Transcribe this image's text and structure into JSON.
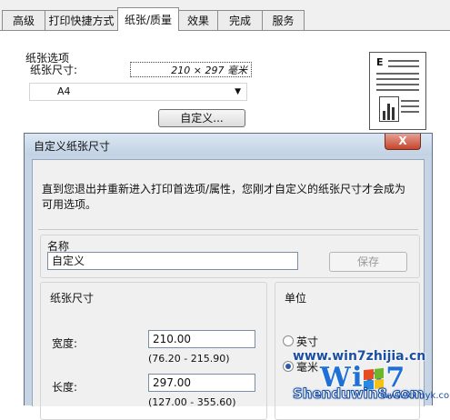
{
  "tabs": [
    {
      "label": "高级"
    },
    {
      "label": "打印快捷方式"
    },
    {
      "label": "纸张/质量"
    },
    {
      "label": "效果"
    },
    {
      "label": "完成"
    },
    {
      "label": "服务"
    }
  ],
  "paper_options": {
    "group_label": "纸张选项",
    "size_label": "纸张尺寸:",
    "size_readout": "210 × 297 毫米",
    "selected_paper": "A4",
    "custom_button": "自定义..."
  },
  "dialog": {
    "title": "自定义纸张尺寸",
    "close_glyph": "X",
    "info": "直到您退出并重新进入打印首选项/属性，您刚才自定义的纸张尺寸才会成为可用选项。",
    "name_label": "名称",
    "name_value": "自定义",
    "save_button": "保存",
    "size_group_label": "纸张尺寸",
    "width_label": "宽度:",
    "width_value": "210.00",
    "width_range": "(76.20 - 215.90)",
    "length_label": "长度:",
    "length_value": "297.00",
    "length_range": "(127.00 - 355.60)",
    "unit_group_label": "单位",
    "units": [
      {
        "label": "英寸",
        "checked": false
      },
      {
        "label": "毫米",
        "checked": true
      }
    ]
  },
  "watermark": {
    "site1": "www.win7zhijia.cn",
    "logo": "Win7",
    "site2": "Shenduwin8.com",
    "site3": "www.kxinyk.com"
  }
}
